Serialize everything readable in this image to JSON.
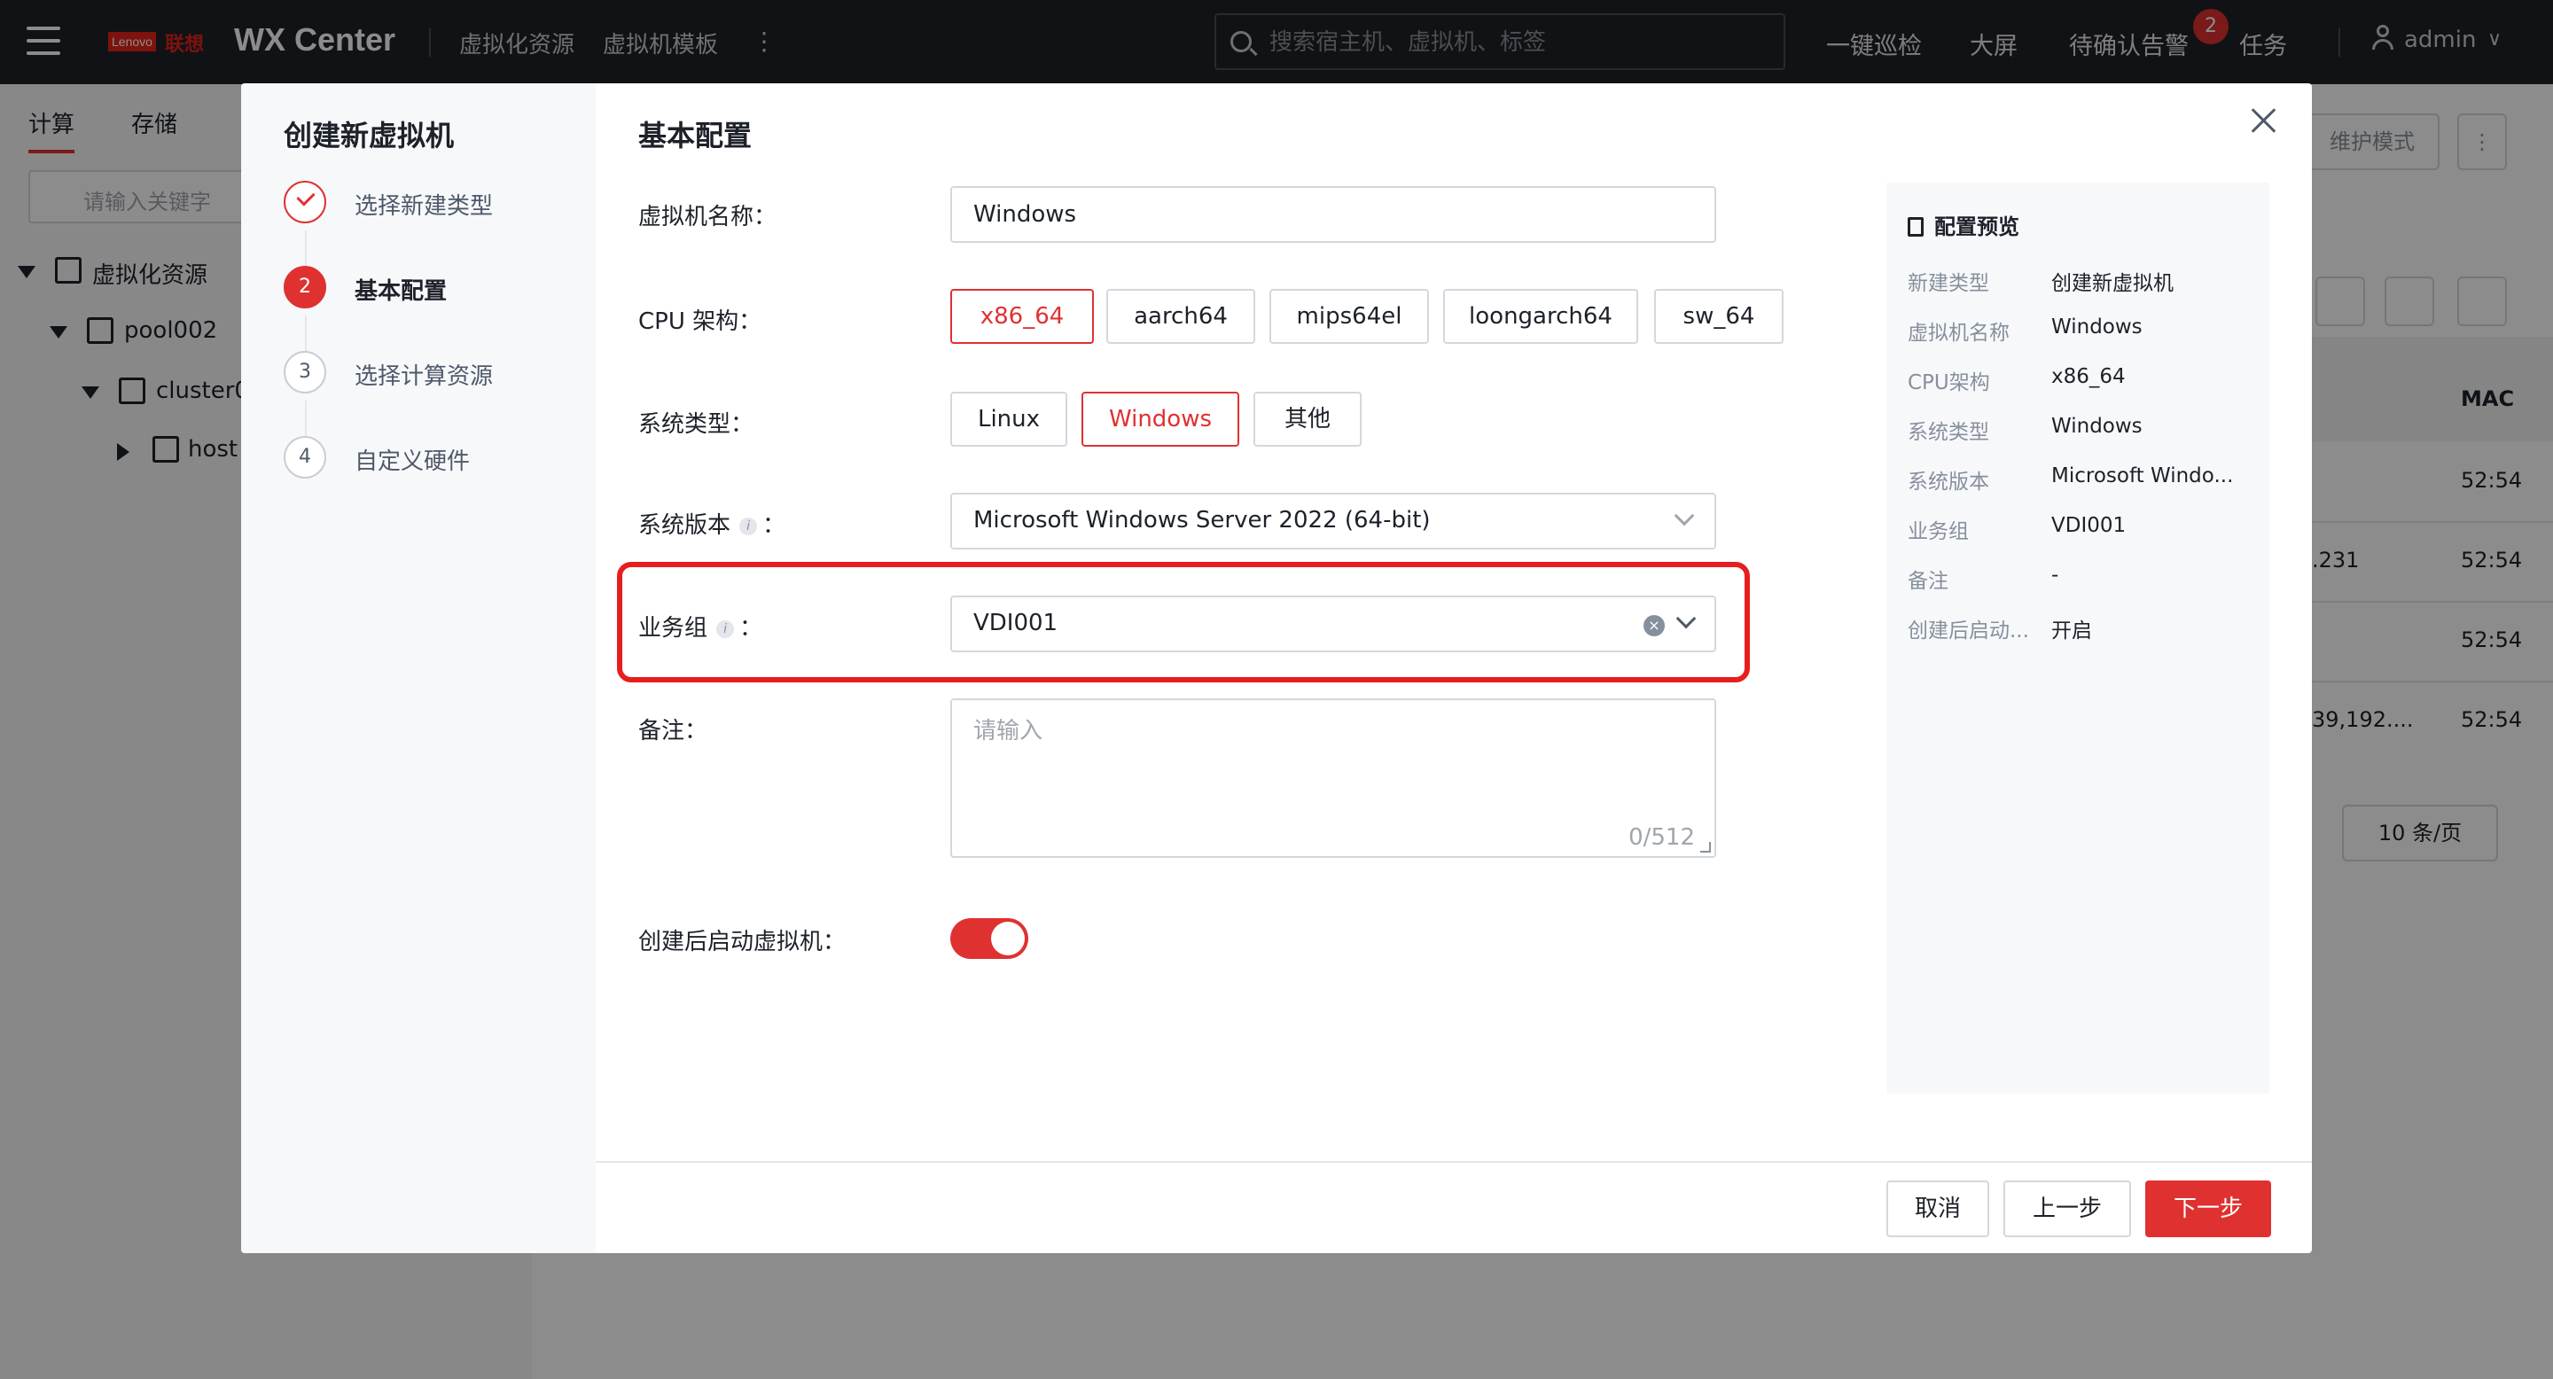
{
  "header": {
    "brand_logo": "Lenovo",
    "brand_cn": "联想",
    "app_title": "WX Center",
    "nav": [
      "虚拟化资源",
      "虚拟机模板"
    ],
    "more_label": "⋮",
    "search_placeholder": "搜索宿主机、虚拟机、标签",
    "actions": [
      "一键巡检",
      "大屏",
      "待确认告警",
      "任务"
    ],
    "alert_count": "2",
    "user": "admin"
  },
  "background": {
    "tabs": [
      "计算",
      "存储"
    ],
    "search_placeholder": "请输入关键字",
    "tree": [
      "虚拟化资源",
      "pool002",
      "cluster0",
      "host"
    ],
    "maintenance_label": "维护模式",
    "column_head": "MAC",
    "cells": [
      "52:54",
      ".231",
      "52:54",
      "52:54",
      "39,192....",
      "52:54",
      "52:54"
    ],
    "page_size": "10 条/页"
  },
  "dialog": {
    "title": "创建新虚拟机",
    "steps": [
      {
        "num": "1",
        "label": "选择新建类型",
        "state": "done"
      },
      {
        "num": "2",
        "label": "基本配置",
        "state": "active"
      },
      {
        "num": "3",
        "label": "选择计算资源",
        "state": "pending"
      },
      {
        "num": "4",
        "label": "自定义硬件",
        "state": "pending"
      }
    ],
    "section_title": "基本配置",
    "form": {
      "name_label": "虚拟机名称：",
      "name_value": "Windows",
      "cpu_label": "CPU 架构：",
      "cpu_options": [
        "x86_64",
        "aarch64",
        "mips64el",
        "loongarch64",
        "sw_64"
      ],
      "cpu_selected": "x86_64",
      "os_type_label": "系统类型：",
      "os_type_options": [
        "Linux",
        "Windows",
        "其他"
      ],
      "os_type_selected": "Windows",
      "os_version_label": "系统版本",
      "os_version_value": "Microsoft Windows Server 2022 (64-bit)",
      "biz_group_label": "业务组",
      "biz_group_value": "VDI001",
      "colon": "：",
      "remark_label": "备注：",
      "remark_placeholder": "请输入",
      "remark_count": "0/512",
      "autostart_label": "创建后启动虚拟机：",
      "autostart_on": true
    },
    "preview": {
      "title": "配置预览",
      "rows": [
        {
          "key": "新建类型",
          "value": "创建新虚拟机"
        },
        {
          "key": "虚拟机名称",
          "value": "Windows"
        },
        {
          "key": "CPU架构",
          "value": "x86_64"
        },
        {
          "key": "系统类型",
          "value": "Windows"
        },
        {
          "key": "系统版本",
          "value": "Microsoft Windo..."
        },
        {
          "key": "业务组",
          "value": "VDI001"
        },
        {
          "key": "备注",
          "value": "-"
        },
        {
          "key": "创建后启动...",
          "value": "开启"
        }
      ]
    },
    "footer": {
      "cancel": "取消",
      "prev": "上一步",
      "next": "下一步"
    }
  },
  "colors": {
    "accent": "#e03131",
    "highlight_box": "#e81e1e",
    "topbar": "#1f2227"
  }
}
